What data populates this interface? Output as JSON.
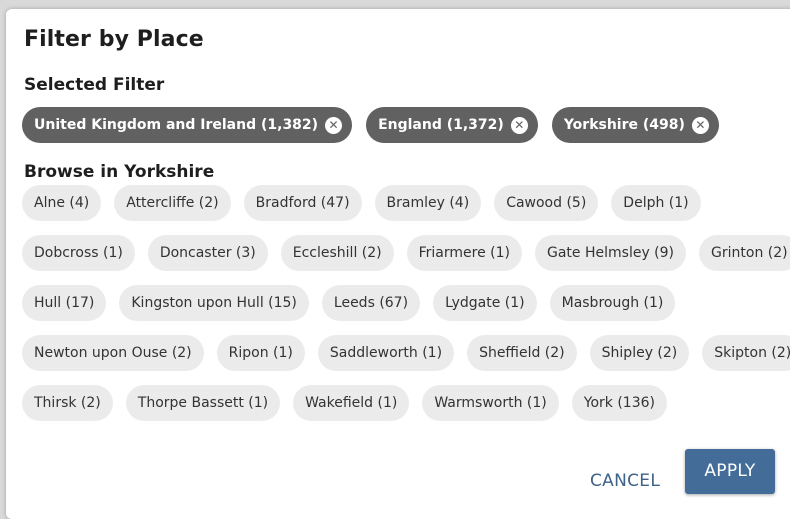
{
  "dialog": {
    "title": "Filter by Place",
    "selected_label": "Selected Filter",
    "browse_label": "Browse in Yorkshire",
    "cancel_label": "CANCEL",
    "apply_label": "APPLY"
  },
  "selected_filters": [
    {
      "label": "United Kingdom and Ireland (1,382)",
      "remove_icon": "close-circle-icon"
    },
    {
      "label": "England (1,372)",
      "remove_icon": "close-circle-icon"
    },
    {
      "label": "Yorkshire (498)",
      "remove_icon": "close-circle-icon"
    }
  ],
  "places": [
    [
      "Alne (4)",
      "Attercliffe (2)",
      "Bradford (47)",
      "Bramley (4)",
      "Cawood (5)",
      "Delph (1)"
    ],
    [
      "Dobcross (1)",
      "Doncaster (3)",
      "Eccleshill (2)",
      "Friarmere (1)",
      "Gate Helmsley (9)",
      "Grinton (2)"
    ],
    [
      "Hull (17)",
      "Kingston upon Hull (15)",
      "Leeds (67)",
      "Lydgate (1)",
      "Masbrough (1)"
    ],
    [
      "Newton upon Ouse (2)",
      "Ripon (1)",
      "Saddleworth (1)",
      "Sheffield (2)",
      "Shipley (2)",
      "Skipton (2)"
    ],
    [
      "Thirsk (2)",
      "Thorpe Bassett (1)",
      "Wakefield (1)",
      "Warmsworth (1)",
      "York (136)"
    ]
  ],
  "colors": {
    "selected_chip_bg": "#616161",
    "chip_bg": "#ebebeb",
    "accent": "#436c98"
  }
}
